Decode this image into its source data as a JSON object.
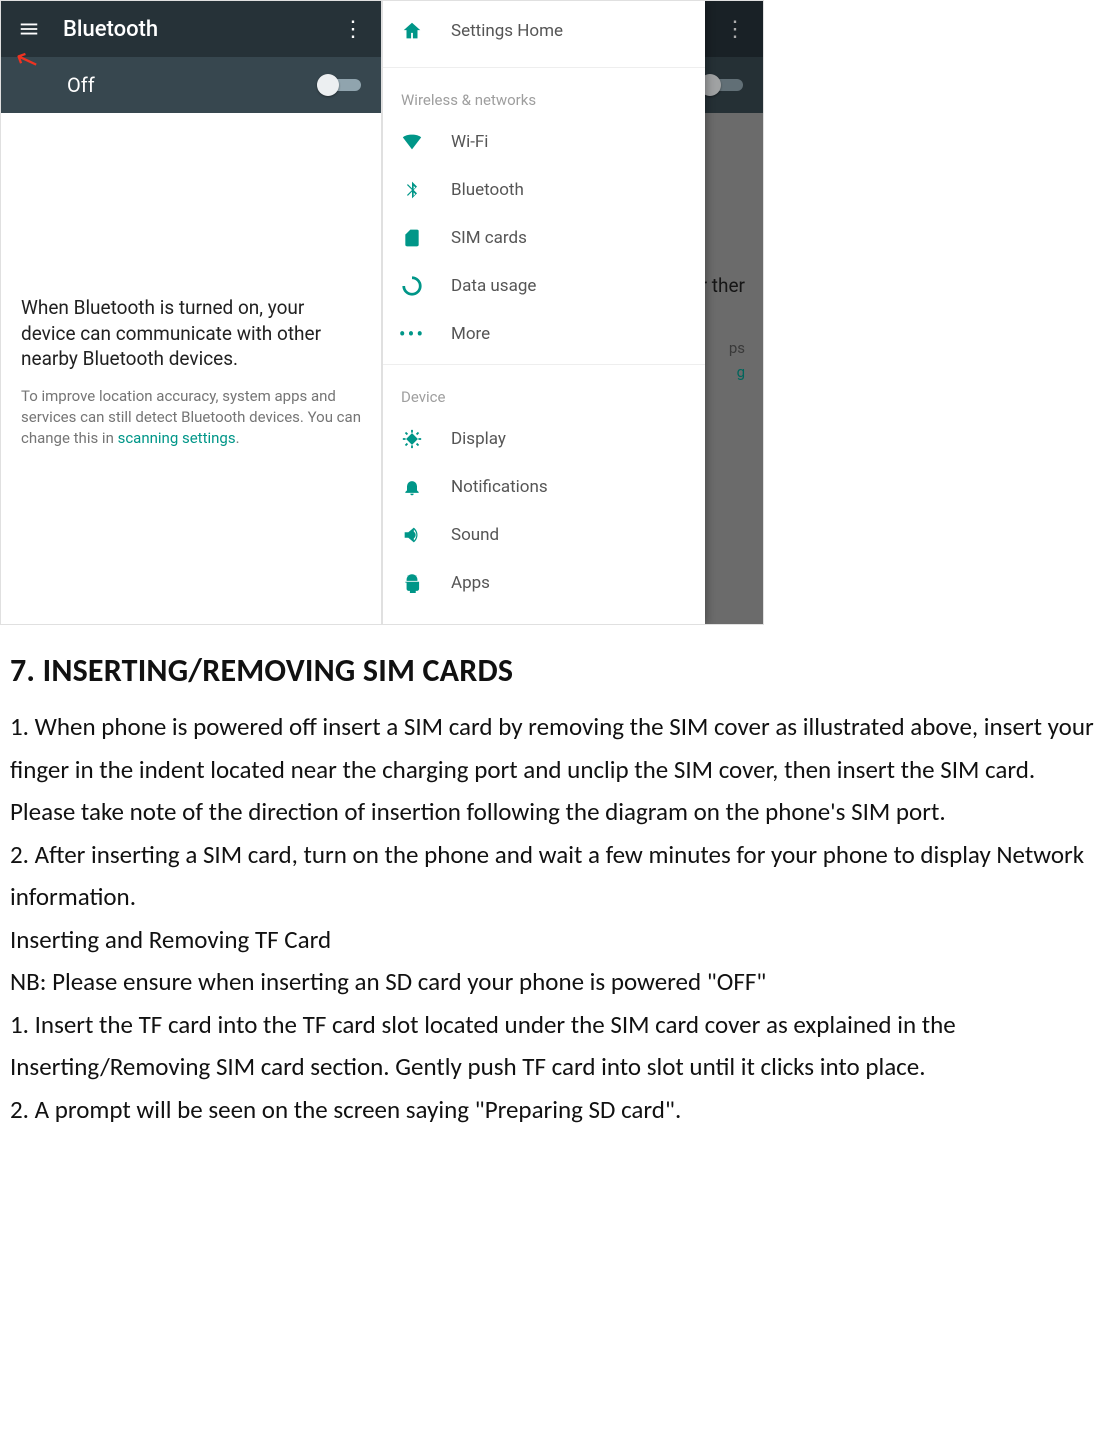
{
  "phoneA": {
    "title": "Bluetooth",
    "toggle_state": "Off",
    "headline": "When Bluetooth is turned on, your device can communicate with other nearby Bluetooth devices.",
    "sub_prefix": "To improve location accuracy, system apps and services can still detect Bluetooth devices. You can change this in ",
    "sub_link": "scanning settings",
    "sub_suffix": "."
  },
  "phoneB": {
    "behind_peek1": "ur\nther",
    "behind_peek2": "ps",
    "behind_peek3": "g"
  },
  "drawer": {
    "home": "Settings Home",
    "section1": "Wireless & networks",
    "wifi": "Wi-Fi",
    "bluetooth": "Bluetooth",
    "sim": "SIM cards",
    "data": "Data usage",
    "more": "More",
    "section2": "Device",
    "display": "Display",
    "notifications": "Notifications",
    "sound": "Sound",
    "apps": "Apps"
  },
  "doc": {
    "heading": "7. INSERTING/REMOVING SIM CARDS",
    "p1": "1. When phone is powered off insert a SIM card by removing the SIM cover as illustrated above, insert your finger in the indent located near the charging port and unclip the SIM cover, then insert the SIM card. Please take note of the direction of insertion following the diagram on the phone's SIM port.",
    "p2": "2.    After inserting a SIM card, turn on the phone and wait a few minutes for your phone to display Network information.",
    "p3": "Inserting and Removing TF Card",
    "p4": "NB: Please ensure when inserting an SD card your phone is powered \"OFF\"",
    "p5": "1. Insert the TF card into the TF card slot located under the SIM card cover as explained in the Inserting/Removing SIM card section. Gently push TF card into slot until it clicks into place.",
    "p6": "2. A prompt will be seen on the screen saying \"Preparing SD card\"."
  }
}
